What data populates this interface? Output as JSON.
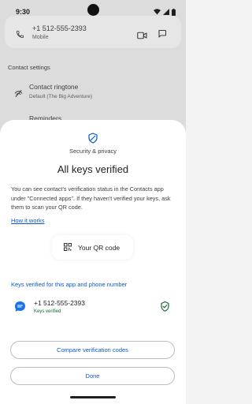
{
  "status_bar": {
    "time": "9:30"
  },
  "background": {
    "phone_number": "+1 512-555-2393",
    "phone_type": "Mobile",
    "section_title": "Contact settings",
    "ringtone_title": "Contact ringtone",
    "ringtone_value": "Default (The Big Adventure)",
    "reminders_title": "Reminders"
  },
  "sheet": {
    "label": "Security & privacy",
    "title": "All keys verified",
    "body": "You can see contact's verification status in the Contacts app under \"Connected apps\". If they haven't verified your keys, ask them to scan your QR code.",
    "how_link": "How it works",
    "qr_button_label": "Your QR code",
    "keys_header": "Keys verified for this app and phone number",
    "verified_number": "+1 512-555-2393",
    "verified_status": "Keys verified",
    "compare_button_label": "Compare verification codes",
    "done_button_label": "Done"
  },
  "colors": {
    "accent": "#0b57d0",
    "verified_green": "#146c2e",
    "sheet_bg": "#ffffff",
    "scrim_bg": "#dcdcdc"
  }
}
